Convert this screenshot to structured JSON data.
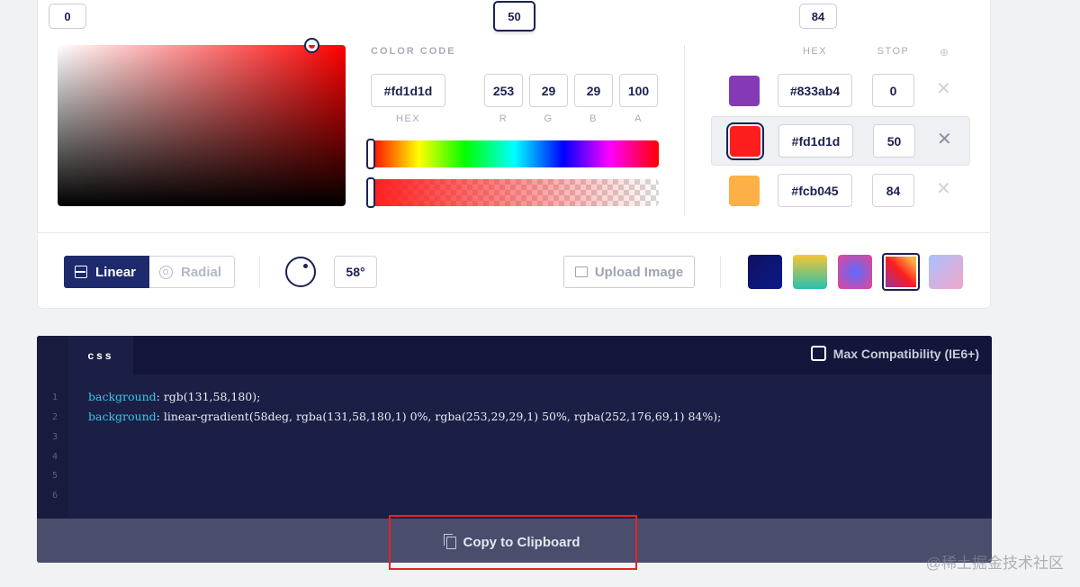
{
  "stop_markers": [
    "0",
    "50",
    "84"
  ],
  "color_code": {
    "section_label": "COLOR CODE",
    "hex_value": "#fd1d1d",
    "r": "253",
    "g": "29",
    "b": "29",
    "a": "100",
    "labels": {
      "hex": "HEX",
      "r": "R",
      "g": "G",
      "b": "B",
      "a": "A"
    }
  },
  "picker": {
    "hue": "#ff0000",
    "alpha": 1.0
  },
  "stops_table": {
    "hex_header": "HEX",
    "stop_header": "STOP",
    "add_icon": "plus-circle-icon",
    "stops": [
      {
        "color": "#833ab4",
        "hex": "#833ab4",
        "stop": "0",
        "active": false
      },
      {
        "color": "#fd1d1d",
        "hex": "#fd1d1d",
        "stop": "50",
        "active": true
      },
      {
        "color": "#fcb045",
        "hex": "#fcb045",
        "stop": "84",
        "active": false
      }
    ]
  },
  "toolbar": {
    "linear_label": "Linear",
    "radial_label": "Radial",
    "angle_value": "58°",
    "upload_label": "Upload Image"
  },
  "presets": [
    {
      "name": "preset-navy",
      "colors": [
        "#12105e",
        "#0a1a8a"
      ]
    },
    {
      "name": "preset-gold-teal",
      "colors": [
        "#f7c632",
        "#28c0b0"
      ]
    },
    {
      "name": "preset-pink-blue",
      "colors": [
        "#e84393",
        "#5b6cff"
      ]
    },
    {
      "name": "preset-current",
      "colors": [
        "#833ab4",
        "#fd1d1d",
        "#fcb045"
      ],
      "selected": true
    },
    {
      "name": "preset-lilac-pink",
      "colors": [
        "#a8c0ff",
        "#f3a6c8"
      ]
    }
  ],
  "code": {
    "tab_label": "css",
    "max_compat_label": "Max Compatibility (IE6+)",
    "line_numbers": [
      "1",
      "2",
      "3",
      "4",
      "5",
      "6"
    ],
    "line1_prop": "background",
    "line1_value": ": rgb(131,58,180);",
    "line2_prop": "background",
    "line2_value": ": linear-gradient(58deg, rgba(131,58,180,1) 0%, rgba(253,29,29,1) 50%, rgba(252,176,69,1) 84%);",
    "copy_label": "Copy to Clipboard"
  },
  "watermark": "@稀土掘金技术社区"
}
